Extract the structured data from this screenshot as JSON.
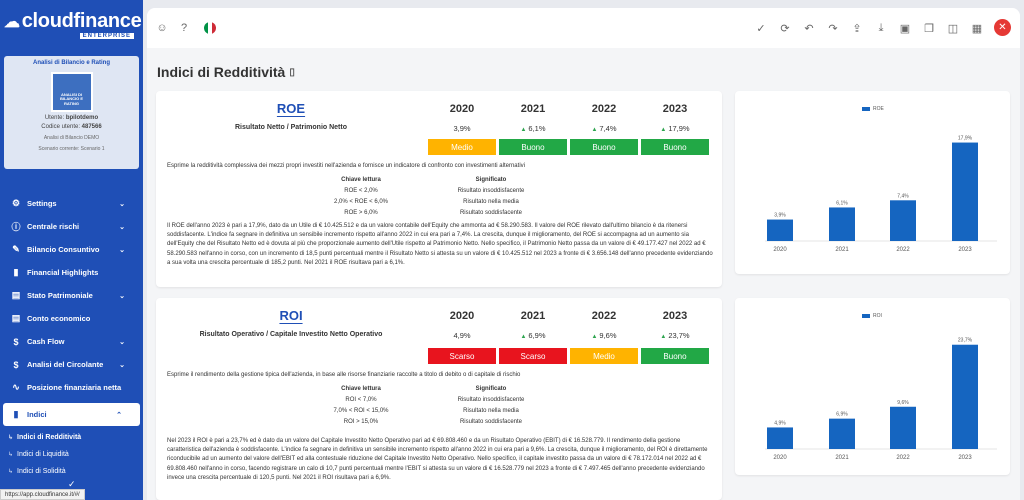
{
  "app": {
    "logo": "cloudfinance",
    "logo_sub": "ENTERPRISE",
    "status_url": "https://app.cloudfinance.it/#/"
  },
  "card": {
    "title": "Analisi di Bilancio e Rating",
    "image_caption": "ANALISI DI BILANCIO E RATING",
    "user_label": "Utente:",
    "user": "bpilotdemo",
    "code_label": "Codice utente:",
    "code": "487566",
    "company": "Analisi di Bilancio DEMO",
    "scenario": "Scenario corrente: Scenario 1"
  },
  "nav": [
    {
      "label": "Settings",
      "icon": "gear-icon",
      "glyph": "⚙",
      "chevron": true
    },
    {
      "label": "Centrale rischi",
      "icon": "info-icon",
      "glyph": "ⓘ",
      "chevron": true
    },
    {
      "label": "Bilancio Consuntivo",
      "icon": "edit-icon",
      "glyph": "✎",
      "chevron": true
    },
    {
      "label": "Financial Highlights",
      "icon": "bar-chart-icon",
      "glyph": "▮",
      "chevron": false
    },
    {
      "label": "Stato Patrimoniale",
      "icon": "document-icon",
      "glyph": "▤",
      "chevron": true
    },
    {
      "label": "Conto economico",
      "icon": "document-icon",
      "glyph": "▤",
      "chevron": false
    },
    {
      "label": "Cash Flow",
      "icon": "dollar-icon",
      "glyph": "$",
      "chevron": true
    },
    {
      "label": "Analisi del Circolante",
      "icon": "dollar-icon",
      "glyph": "$",
      "chevron": true
    },
    {
      "label": "Posizione finanziaria netta",
      "icon": "trend-icon",
      "glyph": "∿",
      "chevron": false
    }
  ],
  "nav_active": {
    "label": "Indici",
    "icon": "bar-chart-icon",
    "glyph": "▮"
  },
  "subnav": [
    {
      "label": "Indici di Redditività",
      "current": true
    },
    {
      "label": "Indici di Liquidità",
      "current": false
    },
    {
      "label": "Indici di Solidità",
      "current": false
    }
  ],
  "toolbar": {
    "left_icons": [
      "support-icon",
      "help-icon"
    ],
    "flag_colors": [
      "#009246",
      "#ffffff",
      "#ce2b37"
    ],
    "right_icons": [
      {
        "name": "check-icon",
        "glyph": "✓"
      },
      {
        "name": "refresh-icon",
        "glyph": "⟳"
      },
      {
        "name": "undo-icon",
        "glyph": "↶"
      },
      {
        "name": "redo-icon",
        "glyph": "↷"
      },
      {
        "name": "upload-icon",
        "glyph": "⇪"
      },
      {
        "name": "download-icon",
        "glyph": "⤓"
      },
      {
        "name": "save-icon",
        "glyph": "▣"
      },
      {
        "name": "copy-icon",
        "glyph": "❐"
      },
      {
        "name": "columns-icon",
        "glyph": "◫"
      },
      {
        "name": "layout-icon",
        "glyph": "▦"
      }
    ],
    "close_glyph": "✕"
  },
  "page_title": "Indici di Redditività",
  "years": [
    "2020",
    "2021",
    "2022",
    "2023"
  ],
  "roe": {
    "name": "ROE",
    "formula": "Risultato Netto / Patrimonio Netto",
    "values": [
      "3,9%",
      "6,1%",
      "7,4%",
      "17,9%"
    ],
    "up": [
      false,
      true,
      true,
      true
    ],
    "judgements": [
      "Medio",
      "Buono",
      "Buono",
      "Buono"
    ],
    "description": "Esprime la redditività complessiva dei mezzi propri investiti nell'azienda e fornisce un indicatore di confronto con investimenti alternativi",
    "key_header": [
      "Chiave lettura",
      "Significato"
    ],
    "keys": [
      [
        "ROE < 2,0%",
        "Risultato insoddisfacente"
      ],
      [
        "2,0% < ROE < 6,0%",
        "Risultato nella media"
      ],
      [
        "ROE > 6,0%",
        "Risultato soddisfacente"
      ]
    ],
    "paragraph": "Il ROE dell'anno 2023 è pari a 17,9%, dato da un Utile di € 10.425.512 e da un valore contabile dell'Equity che ammonta ad € 58.290.583. Il valore del ROE rilevato dall'ultimo bilancio è da ritenersi soddisfacente. L'indice fa segnare in definitiva un sensibile incremento rispetto all'anno 2022 in cui era pari a 7,4%. La crescita, dunque il miglioramento, del ROE si accompagna ad un aumento sia dell'Equity che del Risultato Netto ed è dovuta al più che proporzionale aumento dell'Utile rispetto al Patrimonio Netto. Nello specifico, il Patrimonio Netto passa da un valore di € 49.177.427 nel 2022 ad € 58.290.583 nell'anno in corso, con un incremento di 18,5 punti percentuali mentre il Risultato Netto si attesta su un valore di € 10.425.512 nel 2023 a fronte di € 3.656.148 dell'anno precedente evidenziando a sua volta una crescita percentuale di 185,2 punti. Nel 2021 il ROE risultava pari a 6,1%."
  },
  "roi": {
    "name": "ROI",
    "formula": "Risultato Operativo / Capitale Investito Netto Operativo",
    "values": [
      "4,9%",
      "6,9%",
      "9,6%",
      "23,7%"
    ],
    "up": [
      false,
      true,
      true,
      true
    ],
    "judgements": [
      "Scarso",
      "Scarso",
      "Medio",
      "Buono"
    ],
    "description": "Esprime il rendimento della gestione tipica dell'azienda, in base alle risorse finanziarie raccolte a titolo di debito o di capitale di rischio",
    "key_header": [
      "Chiave lettura",
      "Significato"
    ],
    "keys": [
      [
        "ROI < 7,0%",
        "Risultato insoddisfacente"
      ],
      [
        "7,0% < ROI < 15,0%",
        "Risultato nella media"
      ],
      [
        "ROI > 15,0%",
        "Risultato soddisfacente"
      ]
    ],
    "paragraph": "Nel 2023 il ROI è pari a 23,7% ed è dato da un valore del Capitale Investito Netto Operativo pari ad € 69.808.460 e da un Risultato Operativo (EBIT) di € 16.528.779. Il rendimento della gestione caratteristica dell'azienda è soddisfacente. L'indice fa segnare in definitiva un sensibile incremento rispetto all'anno 2022 in cui era pari a 9,6%. La crescita, dunque il miglioramento, del ROI è direttamente riconducibile ad un aumento del valore dell'EBIT ed alla contestuale riduzione del Capitale Investito Netto Operativo. Nello specifico, il capitale investito passa da un valore di € 78.172.014 nel 2022 ad € 69.808.460 nell'anno in corso, facendo registrare un calo di 10,7 punti percentuali mentre l'EBIT si attesta su un valore di € 16.528.779 nel 2023 a fronte di € 7.497.465 dell'anno precedente evidenziando invece una crescita percentuale di 120,5 punti. Nel 2021 il ROI risultava pari a 6,9%."
  },
  "chart_data": [
    {
      "type": "bar",
      "legend": "ROE",
      "categories": [
        "2020",
        "2021",
        "2022",
        "2023"
      ],
      "values": [
        3.9,
        6.1,
        7.4,
        17.9
      ],
      "labels": [
        "3,9%",
        "6,1%",
        "7,4%",
        "17,9%"
      ],
      "ylim": [
        0,
        20
      ],
      "color": "#1565c0",
      "legend_position": "top"
    },
    {
      "type": "bar",
      "legend": "ROI",
      "categories": [
        "2020",
        "2021",
        "2022",
        "2023"
      ],
      "values": [
        4.9,
        6.9,
        9.6,
        23.7
      ],
      "labels": [
        "4,9%",
        "6,9%",
        "9,6%",
        "23,7%"
      ],
      "ylim": [
        0,
        25
      ],
      "color": "#1565c0",
      "legend_position": "top"
    }
  ]
}
